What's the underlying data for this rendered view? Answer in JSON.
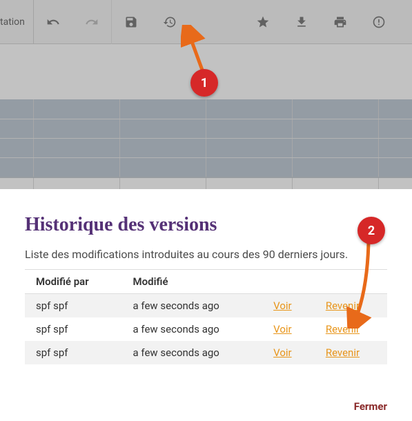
{
  "toolbar": {
    "tab_label": "tation",
    "icons": {
      "undo": "undo-icon",
      "redo": "redo-icon",
      "save": "save-icon",
      "history": "history-icon",
      "star": "star-icon",
      "download": "download-icon",
      "print": "print-icon",
      "info": "info-icon"
    }
  },
  "panel": {
    "title": "Historique des versions",
    "description": "Liste des modifications introduites au cours des 90 derniers jours.",
    "close_label": "Fermer",
    "columns": {
      "modified_by": "Modifié par",
      "modified": "Modifié"
    },
    "rows": [
      {
        "by": "spf spf",
        "when": "a few seconds ago",
        "view": "Voir",
        "revert": "Revenir"
      },
      {
        "by": "spf spf",
        "when": "a few seconds ago",
        "view": "Voir",
        "revert": "Revenir"
      },
      {
        "by": "spf spf",
        "when": "a few seconds ago",
        "view": "Voir",
        "revert": "Revenir"
      }
    ]
  },
  "callouts": {
    "one": "1",
    "two": "2"
  }
}
